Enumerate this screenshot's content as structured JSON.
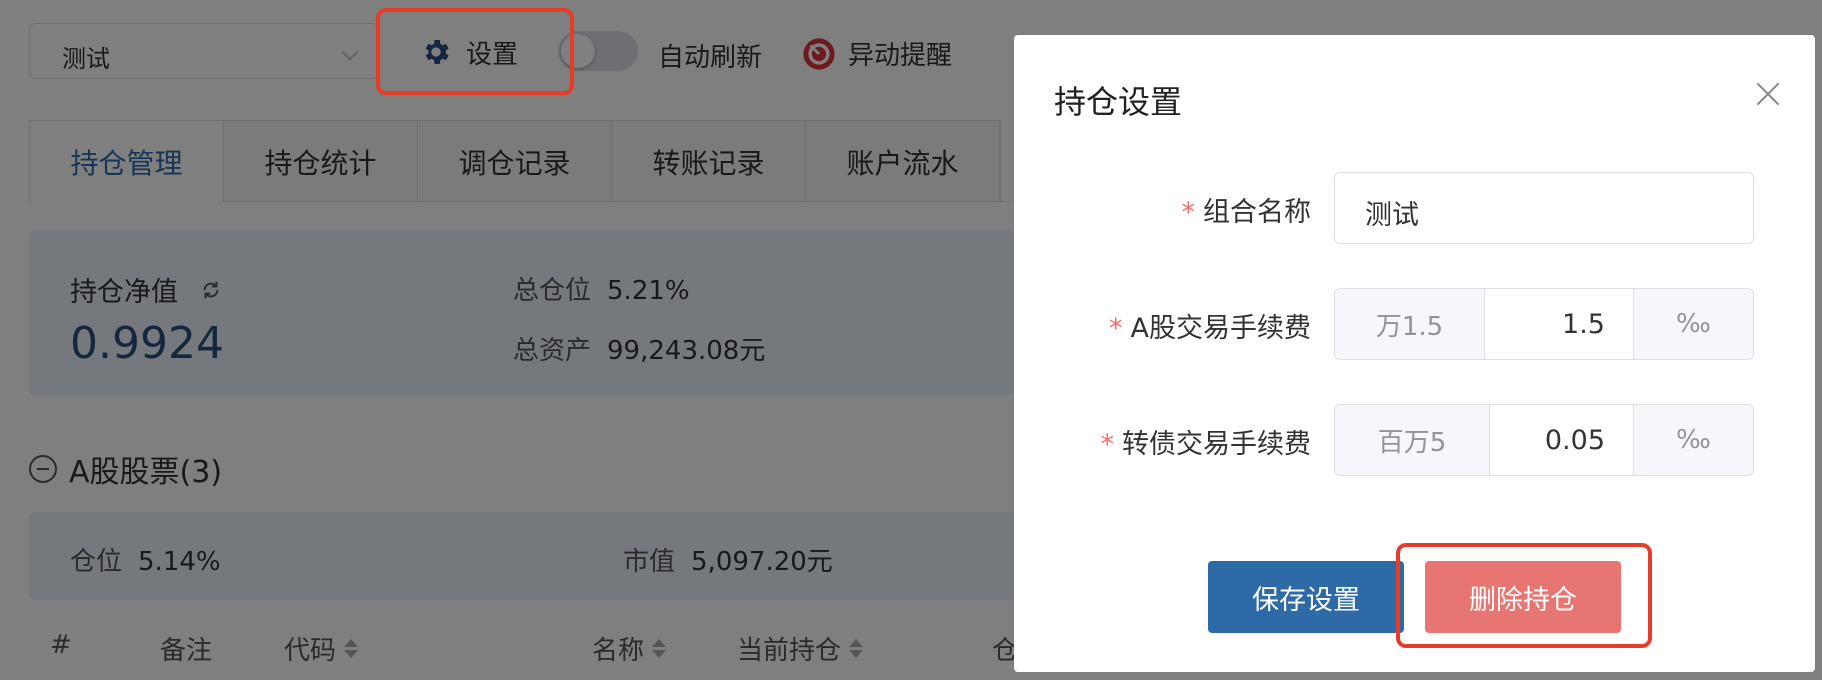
{
  "toolbar": {
    "portfolio_select": "测试",
    "settings_label": "设置",
    "auto_refresh_label": "自动刷新",
    "alert_label": "异动提醒"
  },
  "tabs": [
    "持仓管理",
    "持仓统计",
    "调仓记录",
    "转账记录",
    "账户流水"
  ],
  "summary": {
    "net_value_label": "持仓净值",
    "net_value": "0.9924",
    "total_position_label": "总仓位",
    "total_position": "5.21%",
    "total_assets_label": "总资产",
    "total_assets": "99,243.08元"
  },
  "section": {
    "title": "A股股票(3)",
    "position_label": "仓位",
    "position": "5.14%",
    "market_value_label": "市值",
    "market_value": "5,097.20元"
  },
  "table_headers": [
    "#",
    "备注",
    "代码",
    "名称",
    "当前持仓",
    "仓"
  ],
  "modal": {
    "title": "持仓设置",
    "fields": [
      {
        "label": "组合名称",
        "value": "测试"
      },
      {
        "label": "A股交易手续费",
        "prefix": "万1.5",
        "value": "1.5",
        "suffix": "‰"
      },
      {
        "label": "转债交易手续费",
        "prefix": "百万5",
        "value": "0.05",
        "suffix": "‰"
      }
    ],
    "save_label": "保存设置",
    "delete_label": "删除持仓"
  },
  "colors": {
    "primary": "#2e6aa6",
    "danger": "#e77672",
    "highlight": "#e63c28",
    "active_tab": "#2f6aa8"
  }
}
